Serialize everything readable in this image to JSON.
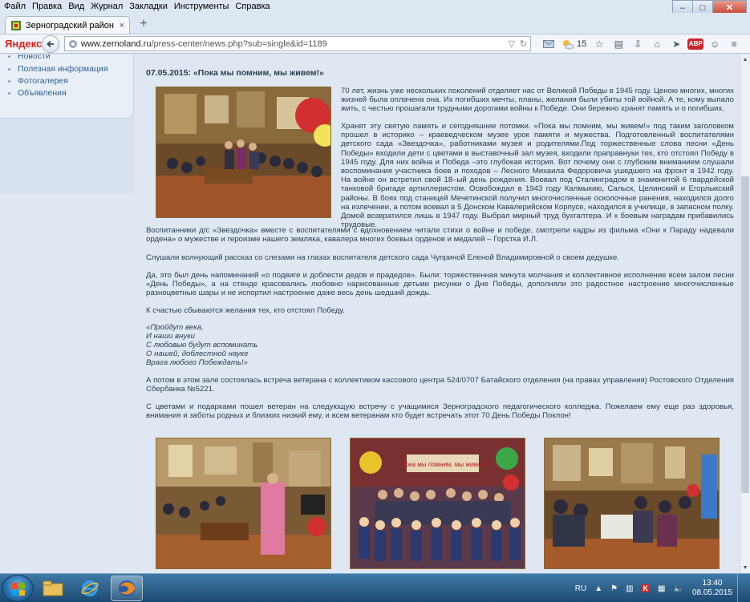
{
  "menu": [
    "Файл",
    "Правка",
    "Вид",
    "Журнал",
    "Закладки",
    "Инструменты",
    "Справка"
  ],
  "tab": {
    "title": "Зерноградский район :: Н...",
    "close": "×",
    "new_tab": "+"
  },
  "window_controls": {
    "minimize": "–",
    "maximize": "□",
    "close": "✕"
  },
  "nav": {
    "brand": "Яндекс",
    "url_host": "www.zernoland.ru",
    "url_path": "/press-center/news.php?sub=single&id=1189",
    "weather_temp": "15",
    "icons": [
      "mail-icon",
      "weather-icon",
      "star-icon",
      "bookmarks-icon",
      "download-icon",
      "home-icon",
      "send-icon",
      "adblock-icon",
      "chat-icon",
      "menu-icon"
    ],
    "adblock_label": "ABP"
  },
  "sidebar": {
    "items": [
      "Новости",
      "Полезная информация",
      "Фотогалерея",
      "Объявления"
    ]
  },
  "article": {
    "headline": "07.05.2015: «Пока мы помним, мы живем!»",
    "p1": "70 лет, жизнь уже нескольких поколений отделяет нас от Великой Победы в 1945 году. Ценою многих, многих жизней была оплачена она. Их погибших мечты, планы, желания были убиты той войной. А те, кому выпало жить, с честью прошагали трудными дорогами войны к Победе. Они бережно хранят память и о погибших.",
    "p2": "Хранят эту святую память и сегодняшние потомки. «Пока мы помним, мы живем!» под таким заголовком прошел в историко – краеведческом музее урок памяти и мужества. Подготовленный воспитателями детского сада «Звездочка», работниками музея и родителями.Под торжественные слова песни «День Победы» входили дети с цветами в выставочный зал музея, входили праправнуки тех, кто отстоял Победу в 1945 году. Для них война и Победа –это глубокая история. Вот почему они с глубоким вниманием слушали воспоминания участника боев и походов – Лесного Михаила Федоровича ушедшего на фронт в 1942 году. На войне он встретил свой 18–ый день рождения. Воевал под Сталинградом в знаменитой 6 гвардейской танковой бригаде артиллеристом. Освобождал в 1943 году Калмыкию, Сальск, Целинский и Егорлыкский районы. В боях под станицей Мечетинской получил многочисленные осколочные ранения, находился долго на излечении, а потом воевал в 5 Донском Кавалерийском Корпусе, находился в училище, в запасном полку. Домой возвратился лишь в 1947 году. Выбрал мирный труд бухгалтера. И к боевым наградам прибавились трудовые.",
    "p3": "Воспитанники д/с «Звездочка» вместе с воспитателями с вдохновением читали стихи о войне и победе, смотрели кадры из фильма «Они к Параду надевали ордена» о мужестве и героизме нашего земляка, кавалера многих боевых орденов и медалей – Горстка И.Л.",
    "p4": "Слушали волнующий рассказ со слезами на глазах воспитателя детского сада Чуприной Еленой Владимировной о своем дедушке.",
    "p5": "Да, это был день напоминаний «о подвиге и доблести дедов и прадедов». Были: торжественная минута молчания и коллективное исполнение всем залом песни «День Победы», а на стенде красовались любовно нарисованные детьми рисунки о Дне Победы, дополняли это радостное настроение многочисленные разноцветные шары и не испортил настроение даже весь день шедший дождь.",
    "p6": "К счастью сбываются желания тех, кто отстоял Победу.",
    "poem": [
      "«Пройдут века,",
      "И наши внуки",
      "С любовью будут вспоминать",
      "О нашей, доблестной науке",
      "Врага любого Побеждать!»"
    ],
    "p7": "А потом в этом зале состоялась встреча ветерана с коллективом кассового центра 524/0707 Батайского отделения (на правах управления) Ростовского Отделения Сбербанка №5221.",
    "p8": "С цветами и подарками пошел ветеран на следующую встречу с учащимися Зерноградского педагогического колледжа. Пожелаем ему еще раз здоровья, внимания и заботы родных и близких низкий ему, и всем ветеранам кто будет встречать этот 70 День Победы Поклон!",
    "photo_banner": "Пока мы помним, мы живем"
  },
  "taskbar": {
    "apps": [
      "explorer-icon",
      "ie-icon",
      "firefox-icon"
    ],
    "lang": "RU",
    "time": "13:40",
    "date": "08.05.2015"
  },
  "colors": {
    "accent_red": "#e0201b",
    "link_blue": "#2f5f95",
    "text": "#2d3b50",
    "page_bg": "#dfe8f2"
  }
}
